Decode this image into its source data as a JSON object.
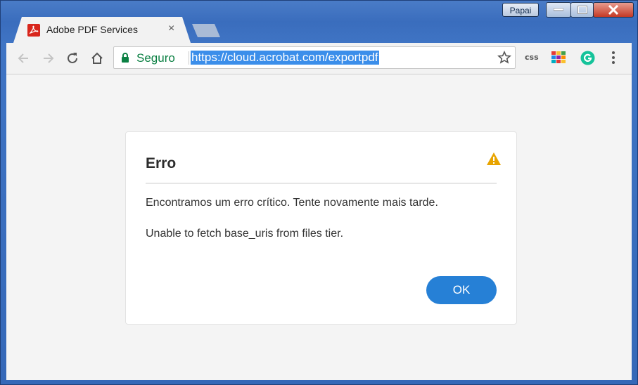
{
  "window": {
    "user_label": "Papai"
  },
  "tab": {
    "title": "Adobe PDF Services",
    "close_glyph": "×",
    "favicon": "adobe-pdf-icon"
  },
  "toolbar": {
    "secure_label": "Seguro",
    "url": "https://cloud.acrobat.com/exportpdf",
    "ext_css_label": "css"
  },
  "dialog": {
    "title": "Erro",
    "message": "Encontramos um erro crítico. Tente novamente mais tarde.",
    "detail": "Unable to fetch base_uris from files tier.",
    "ok_label": "OK",
    "icon": "warning-icon"
  },
  "colors": {
    "accent": "#2680d6",
    "secure": "#0b8043",
    "url_highlight": "#3b8eea",
    "warning": "#e8a400"
  }
}
